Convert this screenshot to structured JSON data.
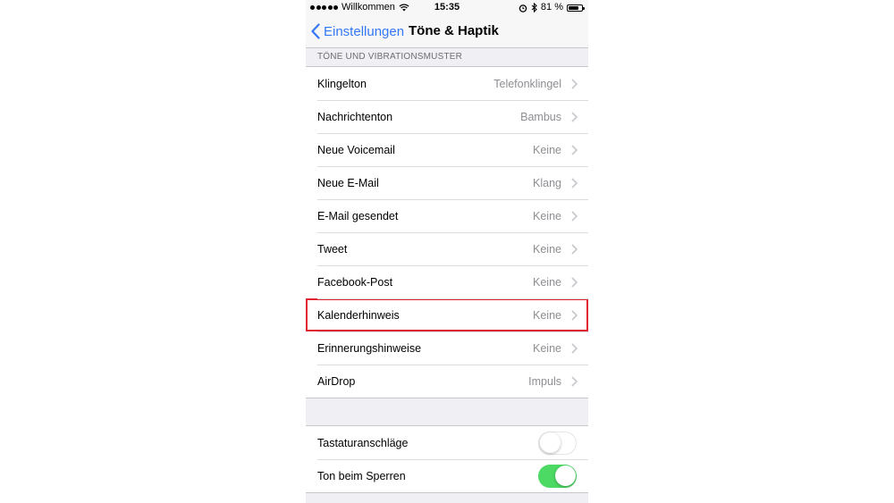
{
  "status_bar": {
    "carrier": "Willkommen",
    "time": "15:35",
    "battery_text": "81 %",
    "battery_level": 0.81
  },
  "nav": {
    "back_label": "Einstellungen",
    "title": "Töne & Haptik"
  },
  "section": {
    "header": "TÖNE UND VIBRATIONSMUSTER"
  },
  "sound_rows": [
    {
      "label": "Klingelton",
      "value": "Telefonklingel"
    },
    {
      "label": "Nachrichtenton",
      "value": "Bambus"
    },
    {
      "label": "Neue Voicemail",
      "value": "Keine"
    },
    {
      "label": "Neue E-Mail",
      "value": "Klang"
    },
    {
      "label": "E-Mail gesendet",
      "value": "Keine"
    },
    {
      "label": "Tweet",
      "value": "Keine"
    },
    {
      "label": "Facebook-Post",
      "value": "Keine"
    },
    {
      "label": "Kalenderhinweis",
      "value": "Keine"
    },
    {
      "label": "Erinnerungshinweise",
      "value": "Keine"
    },
    {
      "label": "AirDrop",
      "value": "Impuls"
    }
  ],
  "toggles": [
    {
      "label": "Tastaturanschläge",
      "on": false
    },
    {
      "label": "Ton beim Sperren",
      "on": true
    }
  ],
  "colors": {
    "accent": "#3478f6",
    "toggle_on": "#4cd964",
    "highlight": "#e0242f"
  }
}
